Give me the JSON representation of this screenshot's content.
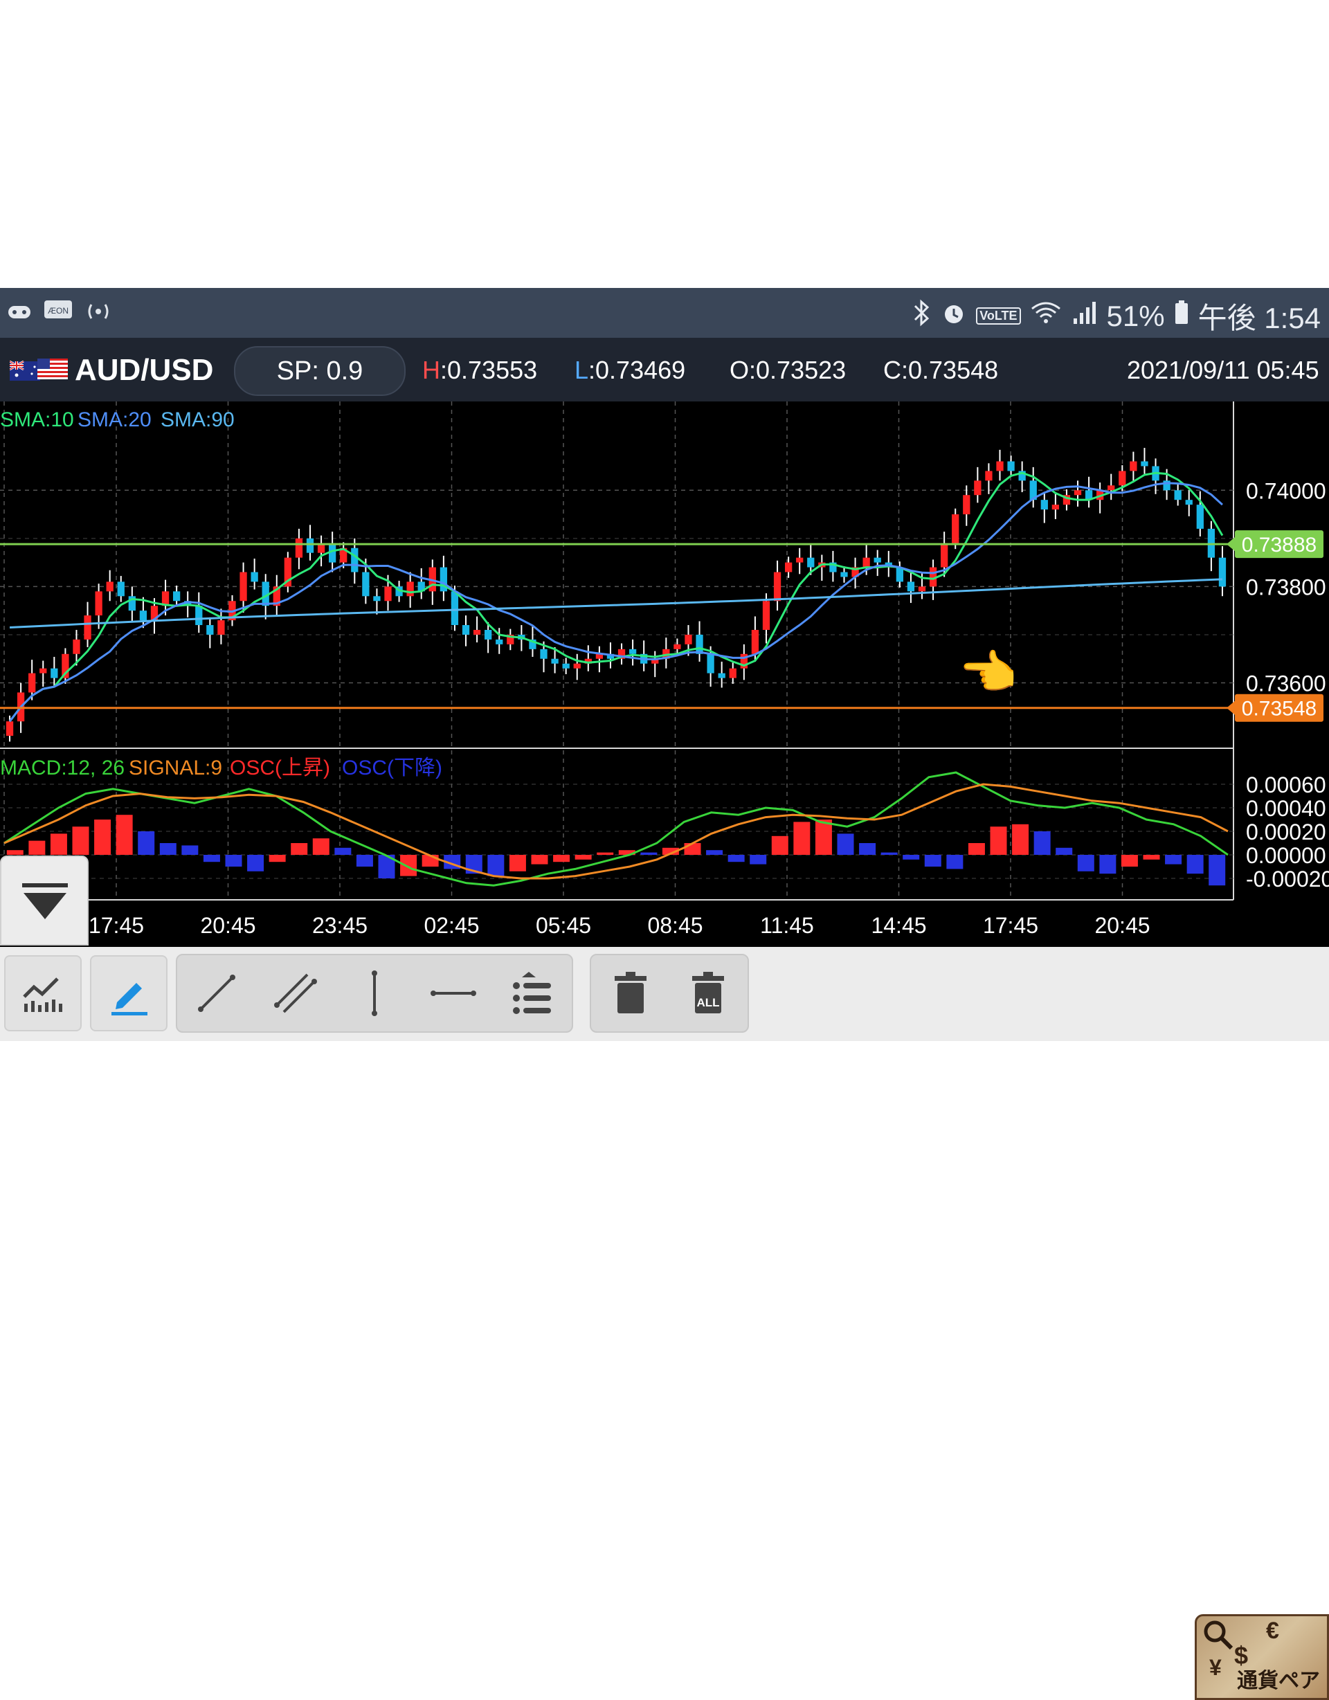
{
  "status_bar": {
    "left_icons": [
      "game-controller-icon",
      "aeon-app-icon",
      "broadcast-icon"
    ],
    "right_icons": [
      "bluetooth-icon",
      "alarm-icon",
      "volte-icon",
      "wifi-icon",
      "signal-icon",
      "battery-icon"
    ],
    "volte_label": "VoLTE",
    "battery": "51%",
    "time": "午後 1:54"
  },
  "header": {
    "pair": "AUD/USD",
    "spread": "SP: 0.9",
    "high_key": "H",
    "high_value": ":0.73553",
    "low_key": "L",
    "low_value": ":0.73469",
    "open": "O:0.73523",
    "close": "C:0.73548",
    "datetime": "2021/09/11  05:45"
  },
  "chart_data": [
    {
      "type": "candlestick",
      "title": "",
      "legend": [
        "SMA:10",
        "SMA:20",
        "SMA:90"
      ],
      "legend_colors": [
        "#2ee87a",
        "#4f8ef7",
        "#5ab8f0"
      ],
      "y_ticks": [
        "0.74000",
        "0.73800",
        "0.73600"
      ],
      "ylim": [
        0.7348,
        0.7417
      ],
      "price_lines": [
        {
          "label": "0.73888",
          "value": 0.73888,
          "color": "#7fcf4f"
        },
        {
          "label": "0.73548",
          "value": 0.73548,
          "color": "#f07a1a"
        }
      ],
      "x_ticks": [
        "17:45",
        "20:45",
        "23:45",
        "02:45",
        "05:45",
        "08:45",
        "11:45",
        "14:45",
        "17:45",
        "20:45"
      ],
      "up_color": "#ff2222",
      "down_color": "#19b6e6",
      "closes": [
        0.7352,
        0.7358,
        0.7362,
        0.7363,
        0.7361,
        0.7366,
        0.7369,
        0.7374,
        0.7379,
        0.7381,
        0.7378,
        0.7375,
        0.7373,
        0.7376,
        0.7379,
        0.7377,
        0.7376,
        0.7372,
        0.737,
        0.7373,
        0.7377,
        0.7383,
        0.7381,
        0.7376,
        0.738,
        0.7386,
        0.739,
        0.7387,
        0.7389,
        0.7385,
        0.7388,
        0.7383,
        0.7378,
        0.7377,
        0.738,
        0.7378,
        0.7381,
        0.7379,
        0.7384,
        0.7379,
        0.7372,
        0.737,
        0.7371,
        0.7369,
        0.7368,
        0.737,
        0.7369,
        0.7367,
        0.7365,
        0.7364,
        0.7363,
        0.7364,
        0.7365,
        0.7366,
        0.7365,
        0.7367,
        0.7366,
        0.7364,
        0.7365,
        0.7367,
        0.7368,
        0.737,
        0.7366,
        0.7362,
        0.7361,
        0.7363,
        0.7366,
        0.7371,
        0.7377,
        0.7383,
        0.7385,
        0.7386,
        0.7384,
        0.7385,
        0.7383,
        0.7382,
        0.7384,
        0.7386,
        0.7385,
        0.7384,
        0.7381,
        0.7379,
        0.738,
        0.7384,
        0.7389,
        0.7395,
        0.7399,
        0.7402,
        0.7404,
        0.7406,
        0.7404,
        0.7402,
        0.7398,
        0.7396,
        0.7397,
        0.7399,
        0.74,
        0.7398,
        0.74,
        0.7401,
        0.7404,
        0.7406,
        0.7405,
        0.7402,
        0.74,
        0.7398,
        0.7397,
        0.7392,
        0.7386,
        0.738
      ]
    },
    {
      "type": "bar",
      "title": "",
      "legend": [
        "MACD:12, 26",
        "SIGNAL:9",
        "OSC(上昇)",
        "OSC(下降)"
      ],
      "legend_colors": [
        "#39d43a",
        "#f08a24",
        "#ff2a2a",
        "#2633e0"
      ],
      "y_ticks": [
        "0.00060",
        "0.00040",
        "0.00020",
        "0.00000",
        "-0.00020"
      ],
      "ylim": [
        -0.0003,
        0.0008
      ],
      "macd": [
        0.0001,
        0.00025,
        0.0004,
        0.00052,
        0.00056,
        0.00052,
        0.00048,
        0.00044,
        0.0005,
        0.00056,
        0.0005,
        0.00036,
        0.0002,
        0.0001,
        0.0,
        -0.00012,
        -0.00018,
        -0.00024,
        -0.00026,
        -0.00022,
        -0.00016,
        -0.00012,
        -6e-05,
        0.0,
        0.0001,
        0.00028,
        0.00036,
        0.00034,
        0.0004,
        0.00038,
        0.00028,
        0.00024,
        0.00032,
        0.00048,
        0.00066,
        0.0007,
        0.00058,
        0.00046,
        0.00042,
        0.0004,
        0.00044,
        0.0004,
        0.0003,
        0.00026,
        0.00016,
        0.0
      ],
      "signal": [
        0.0001,
        0.0002,
        0.0003,
        0.00042,
        0.0005,
        0.00052,
        0.00049,
        0.00048,
        0.00049,
        0.00051,
        0.0005,
        0.00045,
        0.00036,
        0.00026,
        0.00016,
        6e-05,
        -4e-05,
        -0.00012,
        -0.00018,
        -0.0002,
        -0.0002,
        -0.00018,
        -0.00014,
        -0.0001,
        -4e-05,
        6e-05,
        0.00018,
        0.00026,
        0.00032,
        0.00034,
        0.00033,
        0.00031,
        0.0003,
        0.00034,
        0.00044,
        0.00054,
        0.0006,
        0.00058,
        0.00054,
        0.0005,
        0.00046,
        0.00044,
        0.0004,
        0.00036,
        0.00032,
        0.0002
      ],
      "osc": [
        4e-05,
        0.00012,
        0.00018,
        0.00024,
        0.0003,
        0.00034,
        0.0002,
        0.0001,
        8e-05,
        -6e-05,
        -0.0001,
        -0.00014,
        -6e-05,
        0.0001,
        0.00014,
        6e-05,
        -0.0001,
        -0.0002,
        -0.00018,
        -0.0001,
        -0.00012,
        -0.00016,
        -0.00018,
        -0.00014,
        -8e-05,
        -6e-05,
        -4e-05,
        2e-05,
        4e-05,
        2e-05,
        6e-05,
        0.0001,
        4e-05,
        -6e-05,
        -8e-05,
        0.00016,
        0.00028,
        0.0003,
        0.00018,
        0.0001,
        2e-05,
        -4e-05,
        -0.0001,
        -0.00012,
        0.0001,
        0.00024,
        0.00026,
        0.0002,
        6e-05,
        -0.00014,
        -0.00016,
        -0.0001,
        -4e-05,
        -8e-05,
        -0.00016,
        -0.00026
      ]
    }
  ],
  "toolbar": {
    "buttons": [
      "indicator-button",
      "draw-button",
      "trend-line-button",
      "channel-line-button",
      "vertical-line-button",
      "horizontal-line-button",
      "line-list-button",
      "delete-button",
      "delete-all-button"
    ],
    "delete_all_label": "ALL",
    "currency_button_label": "通貨ペア",
    "currency_symbols": [
      "€",
      "$",
      "¥"
    ]
  }
}
